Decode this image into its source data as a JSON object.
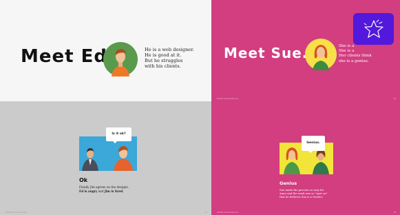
{
  "slides": [
    {
      "title": "Meet Ed.",
      "description": "He is a web designer.\nHe is good at it.\nBut he struggles\nwith his clients.",
      "footer_left": "",
      "footer_right": ""
    },
    {
      "title": "Meet Sue.",
      "description": "She is a\nShe is a\nHer clients think\nshe is a genius.",
      "footer_left": "WOOD Social Media LLC",
      "footer_right": "02"
    },
    {
      "bubble": "Is it ok?",
      "caption_title": "Ok",
      "caption_line1": "Finally Jim agrees on the designs.",
      "caption_line2_pre": "Ed is angry",
      "caption_line2_mid": " and ",
      "caption_line2_post": "Jim is tired.",
      "footer_left": "WOOD Social Media LLC",
      "footer_right": "03"
    },
    {
      "bubble": "Genius.",
      "caption_title": "Genius",
      "caption_text": "Sue made the process so easy for\nAnne and the work was so \"spot on\"\nthat he believes Sue is a Genius!",
      "footer_left": "WOOD Social Media LLC",
      "footer_right": "04"
    }
  ],
  "star_button_icon": "star-icon",
  "colors": {
    "pink": "#d23e80",
    "purple": "#5218db",
    "grey": "#cbcbcb",
    "light": "#f6f6f6"
  }
}
